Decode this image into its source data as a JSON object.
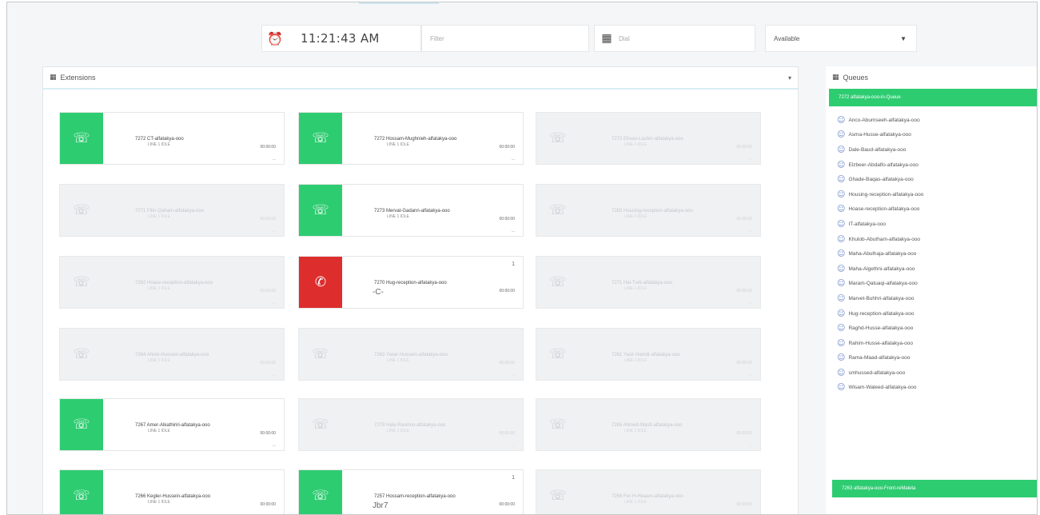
{
  "toolbar": {
    "clock_icon": "alarm-clock-icon",
    "time": "11:21:43 AM",
    "filter_placeholder": "Filter",
    "dial_icon": "dialpad-icon",
    "dial_placeholder": "Dial",
    "status_value": "Available"
  },
  "extensions_panel": {
    "title": "Extensions",
    "collapse_icon": "collapse-caret-icon",
    "items": [
      {
        "name": "7272 CT-alfatakya-ooo",
        "status": "LINE 1 IDLE",
        "duration": "00:00:00",
        "tiny": "---",
        "state": "online"
      },
      {
        "name": "7272 Hossam-Mughnieh-alfatakya-ooo",
        "status": "LINE 1 IDLE",
        "duration": "00:00:00",
        "tiny": "---",
        "state": "online"
      },
      {
        "name": "7272 Ehsan-Lashin-alfatakya-ooo",
        "status": "LINE 1 IDLE",
        "duration": "00:00:00",
        "tiny": "---",
        "state": "offline"
      },
      {
        "name": "7271 Fitin-Qaham-alfatakya-ooo",
        "status": "LINE 1 IDLE",
        "duration": "00:00:00",
        "tiny": "---",
        "state": "offline"
      },
      {
        "name": "7273 Mervat-Gadann-alfatakya-ooo",
        "status": "LINE 1 IDLE",
        "duration": "00:00:00",
        "tiny": "---",
        "state": "online"
      },
      {
        "name": "7283 Housing-reception-alfatakya-ooo",
        "status": "LINE 1 IDLE",
        "duration": "00:00:00",
        "tiny": "---",
        "state": "offline"
      },
      {
        "name": "7262 Hoase-reception-alfatakya-ooo",
        "status": "LINE 1 IDLE",
        "duration": "00:00:00",
        "tiny": "---",
        "state": "offline"
      },
      {
        "name": "7270 Hug-reception-alfatakya-ooo",
        "status": "",
        "duration": "00:00:00",
        "tiny": "",
        "state": "busy",
        "count": "1",
        "sub": "-C-"
      },
      {
        "name": "7271 Hai-Turk-alfatakya-ooo",
        "status": "LINE 1 IDLE",
        "duration": "00:00:00",
        "tiny": "---",
        "state": "offline"
      },
      {
        "name": "7264 Ahrek-Hussein-alfatakya-ooo",
        "status": "LINE 1 IDLE",
        "duration": "00:00:00",
        "tiny": "---",
        "state": "offline"
      },
      {
        "name": "7263 Yaser-Hussein-alfatakya-ooo",
        "status": "LINE 1 IDLE",
        "duration": "00:00:00",
        "tiny": "---",
        "state": "offline"
      },
      {
        "name": "7261 Yasir-Hamdi-alfatakya-ooo",
        "status": "LINE 1 IDLE",
        "duration": "00:00:00",
        "tiny": "---",
        "state": "offline"
      },
      {
        "name": "7267 Amer-Alkathiriri-alfatakya-ooo",
        "status": "LINE 1 IDLE",
        "duration": "00:00:00",
        "tiny": "---",
        "state": "online"
      },
      {
        "name": "7279 Hala-Rasinoo-alfatakya-ooo",
        "status": "LINE 1 IDLE",
        "duration": "00:00:00",
        "tiny": "---",
        "state": "offline"
      },
      {
        "name": "7265 Ahmed-Wasfi-alfatakya-ooo",
        "status": "LINE 1 IDLE",
        "duration": "00:00:00",
        "tiny": "---",
        "state": "offline"
      },
      {
        "name": "7266 Kegler-Hussein-alfatakya-ooo",
        "status": "LINE 1 IDLE",
        "duration": "00:00:00",
        "tiny": "---",
        "state": "online"
      },
      {
        "name": "7257 Hossam-reception-alfatakya-ooo",
        "status": "",
        "duration": "00:00:00",
        "tiny": "---",
        "state": "online",
        "count": "1",
        "sub": "Jbr7"
      },
      {
        "name": "7268 Fer-H-Heaam-alfatakya-ooo",
        "status": "LINE 1 IDLE",
        "duration": "00:00:00",
        "tiny": "---",
        "state": "offline"
      }
    ]
  },
  "queues_panel": {
    "title": "Queues",
    "queue1_title": "7272 alfatakya-ooo-in-Queue",
    "queue2_title": "7263 alfatakya-ooo-Front-reMaleta",
    "agent_icon": "agent-user-icon",
    "members": [
      "Anco-Abumseeh-alfatakya-ooo",
      "Asma-Husse-alfatakya-ooo",
      "Dale-Baud-alfatakya-ooo",
      "Elzbeer-Abdalfo-alfatakya-ooo",
      "Ghade-Baqas-alfatakya-ooo",
      "Housing-reception-alfatakya-ooo",
      "Hoase-reception-alfatakya-ooo",
      "IT-alfatakya-ooo",
      "Khulob-Abutham-alfatakya-ooo",
      "Maha-Abulhaja-alfatakya-ooo",
      "Maha-Algethni-alfatakya-ooo",
      "Maram-Qatuaqi-alfatakya-ooo",
      "Marvet-Buhhri-alfatakya-ooo",
      "Hug-reception-alfatakya-ooo",
      "Raghd-Husse-alfatakya-ooo",
      "Rahim-Husse-alfatakya-ooo",
      "Rama-Maad-alfatakya-ooo",
      "smhussed-alfatakya-ooo",
      "Wisam-Waleed-alfatakya-ooo"
    ]
  },
  "colors": {
    "online": "#2ecc71",
    "busy": "#dd2d2d",
    "offline": "#eff1f3"
  }
}
